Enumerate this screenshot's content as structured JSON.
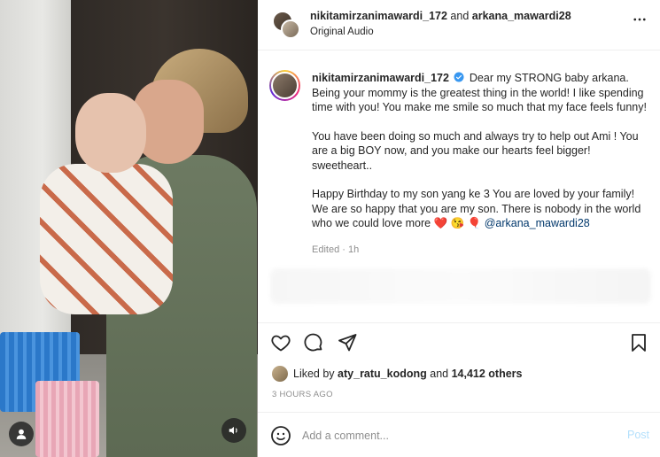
{
  "header": {
    "user1": "nikitamirzanimawardi_172",
    "joiner": "and",
    "user2": "arkana_mawardi28",
    "audio": "Original Audio",
    "more_icon": "more-horizontal-icon"
  },
  "caption": {
    "username": "nikitamirzanimawardi_172",
    "para1": "Dear my STRONG baby arkana. Being your mommy is the greatest thing in the world! I like spending time with you! You make me smile so much that my face feels funny!",
    "para2": "You have been doing so much and always try to help out Ami ! You are a big BOY now, and you make our hearts feel bigger! sweetheart..",
    "para3": "Happy Birthday to my son yang ke 3 You are loved by your family! We are so happy that you are my son. There is nobody in the world who we could love more",
    "emojis": "❤️ 😘 🎈",
    "mention": "@arkana_mawardi28",
    "edited": "Edited · 1h"
  },
  "likes": {
    "prefix": "Liked by",
    "user": "aty_ratu_kodong",
    "and": "and",
    "others": "14,412 others"
  },
  "time_ago": "3 HOURS AGO",
  "comment": {
    "placeholder": "Add a comment...",
    "post_label": "Post"
  },
  "colors": {
    "verified": "#3897f0",
    "post_disabled": "#b2dffc",
    "mention": "#00376b",
    "muted": "#8e8e8e"
  }
}
